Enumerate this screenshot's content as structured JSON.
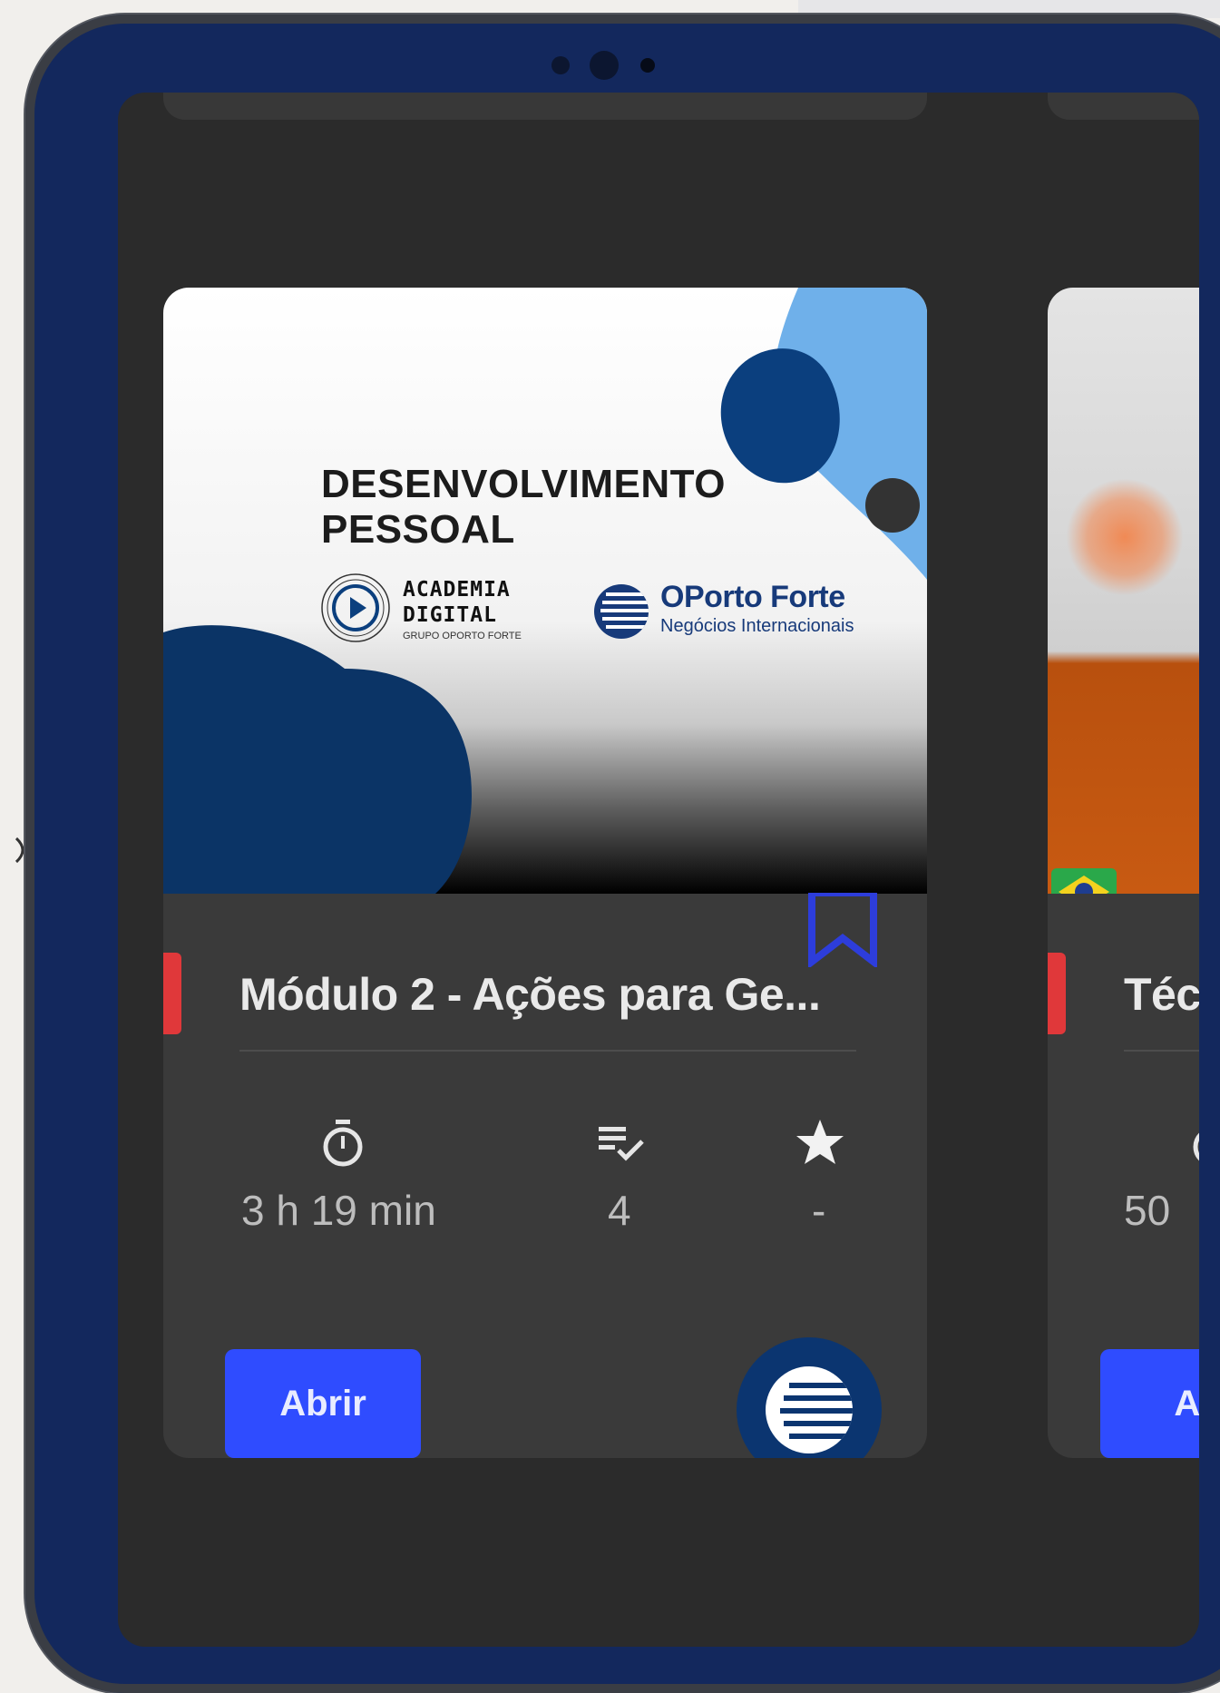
{
  "thumbnail": {
    "title": "DESENVOLVIMENTO\nPESSOAL",
    "academia_name": "ACADEMIA\nDIGITAL",
    "academia_sub": "GRUPO OPORTO FORTE",
    "oporto_name": "OPorto Forte",
    "oporto_sub": "Negócios Internacionais"
  },
  "cards": [
    {
      "title": "Módulo 2 - Ações para Ge...",
      "duration": "3 h 19 min",
      "lessons": "4",
      "rating": "-",
      "open_label": "Abrir",
      "accent_color": "#e0383a"
    },
    {
      "title": "Téc",
      "duration": "50",
      "open_label": "Ab",
      "accent_color": "#e0383a"
    }
  ],
  "icons": [
    "timer-icon",
    "checklist-icon",
    "star-icon",
    "bookmark-icon",
    "oporto-forte-logo-icon"
  ],
  "colors": {
    "tablet_frame": "#13285d",
    "screen_bg": "#2b2b2b",
    "card_bg": "#3a3a3a",
    "button": "#2f4cff",
    "fab": "#0b3570"
  }
}
